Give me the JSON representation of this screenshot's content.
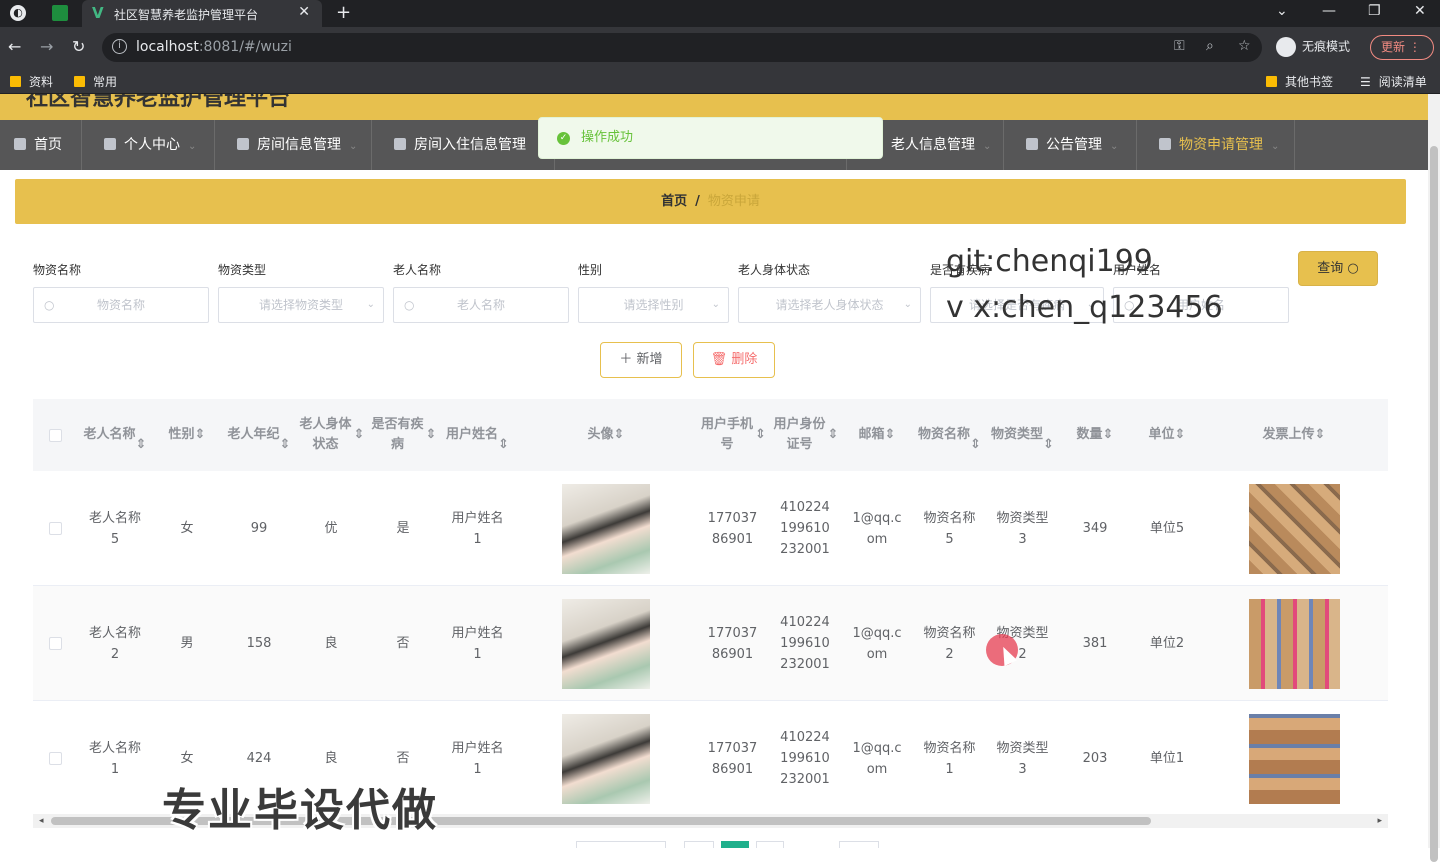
{
  "browser": {
    "tab_title": "社区智慧养老监护管理平台",
    "url_host": "localhost",
    "url_rest": ":8081/#/wuzi",
    "incognito_label": "无痕模式",
    "update_label": "更新",
    "bookmarks": [
      "资料",
      "常用"
    ],
    "bookmarks_right": [
      "其他书签",
      "阅读清单"
    ]
  },
  "app": {
    "title": "社区智慧养老监护管理平台",
    "menu": [
      {
        "label": "首页",
        "active": false
      },
      {
        "label": "个人中心",
        "active": false
      },
      {
        "label": "房间信息管理",
        "active": false
      },
      {
        "label": "房间入住信息管理",
        "active": false
      },
      {
        "label": "老人信息管理",
        "active": false
      },
      {
        "label": "公告管理",
        "active": false
      },
      {
        "label": "物资申请管理",
        "active": true
      }
    ],
    "toast": "操作成功",
    "breadcrumb": {
      "home": "首页",
      "current": "物资申请"
    }
  },
  "filters": {
    "items": [
      {
        "label": "物资名称",
        "placeholder": "物资名称"
      },
      {
        "label": "物资类型",
        "placeholder": "请选择物资类型"
      },
      {
        "label": "老人名称",
        "placeholder": "老人名称"
      },
      {
        "label": "性别",
        "placeholder": "请选择性别"
      },
      {
        "label": "老人身体状态",
        "placeholder": "请选择老人身体状态"
      },
      {
        "label": "是否有疾病",
        "placeholder": "请选择是否有疾病"
      },
      {
        "label": "用户姓名",
        "placeholder": "用户姓名"
      }
    ],
    "query_label": "查询"
  },
  "watermark": {
    "line1": "git:chenqi199",
    "line2": "v x:chen_q123456"
  },
  "actions": {
    "add_label": "＋ 新增",
    "delete_label": "删除"
  },
  "table": {
    "headers": [
      "老人名称",
      "性别",
      "老人年纪",
      "老人身体状态",
      "是否有疾病",
      "用户姓名",
      "头像",
      "用户手机号",
      "用户身份证号",
      "邮箱",
      "物资名称",
      "物资类型",
      "数量",
      "单位",
      "发票上传"
    ],
    "rows": [
      {
        "name": "老人名称5",
        "gender": "女",
        "age": "99",
        "status": "优",
        "disease": "是",
        "user": "用户姓名1",
        "phone": "17703786901",
        "idcard": "410224199610232001",
        "email": "1@qq.com",
        "item": "物资名称5",
        "type": "物资类型3",
        "qty": "349",
        "unit": "单位5"
      },
      {
        "name": "老人名称2",
        "gender": "男",
        "age": "158",
        "status": "良",
        "disease": "否",
        "user": "用户姓名1",
        "phone": "17703786901",
        "idcard": "410224199610232001",
        "email": "1@qq.com",
        "item": "物资名称2",
        "type": "物资类型2",
        "qty": "381",
        "unit": "单位2"
      },
      {
        "name": "老人名称1",
        "gender": "女",
        "age": "424",
        "status": "良",
        "disease": "否",
        "user": "用户姓名1",
        "phone": "17703786901",
        "idcard": "410224199610232001",
        "email": "1@qq.com",
        "item": "物资名称1",
        "type": "物资类型3",
        "qty": "203",
        "unit": "单位1"
      }
    ]
  },
  "overlay": {
    "slogan": "专业毕设代做"
  },
  "colors": {
    "accent": "#e7c04e",
    "menu_bg": "#565657",
    "pager_active": "#20b08c"
  }
}
